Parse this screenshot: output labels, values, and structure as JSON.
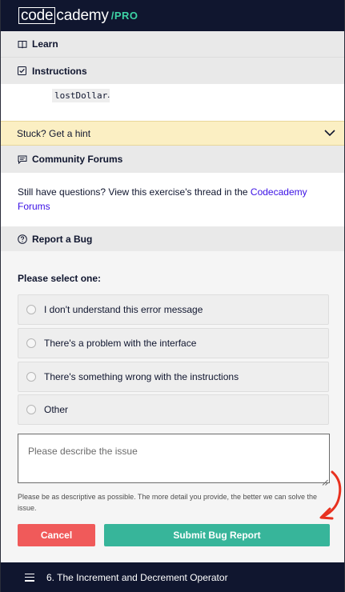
{
  "brand": {
    "logo_box": "code",
    "logo_rest": "cademy",
    "logo_pro": "/PRO"
  },
  "sections": {
    "learn": "Learn",
    "instructions": "Instructions",
    "community": "Community Forums",
    "report_bug": "Report a Bug"
  },
  "instructions_body": {
    "code": "lostDollar",
    "after": "."
  },
  "hint": {
    "label": "Stuck? Get a hint"
  },
  "community_body": {
    "text": "Still have questions? View this exercise's thread in the ",
    "link": "Codecademy Forums"
  },
  "bug_form": {
    "select_label": "Please select one:",
    "options": [
      "I don't understand this error message",
      "There's a problem with the interface",
      "There's something wrong with the instructions",
      "Other"
    ],
    "textarea_placeholder": "Please describe the issue",
    "help_text": "Please be as descriptive as possible. The more detail you provide, the better we can solve the issue.",
    "cancel_label": "Cancel",
    "submit_label": "Submit Bug Report"
  },
  "bottom_bar": {
    "lesson_title": "6. The Increment and Decrement Operator"
  },
  "colors": {
    "navy": "#10162f",
    "pro_green": "#3dd3a5",
    "hint_yellow": "#fbefc3",
    "link_blue": "#3a10e5",
    "cancel_red": "#f05a5a",
    "submit_teal": "#37b59a",
    "annotation_red": "#e8311f"
  },
  "icons": {
    "learn": "book-icon",
    "instructions": "checkbox-icon",
    "community": "chat-bubble-icon",
    "report_bug": "question-circle-icon",
    "hint": "chevron-down-icon",
    "menu": "hamburger-icon"
  }
}
